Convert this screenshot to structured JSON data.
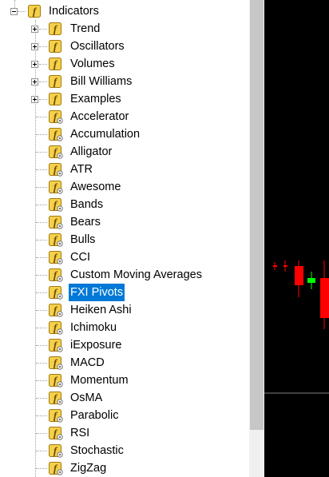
{
  "tree": {
    "root": {
      "label": "Indicators",
      "icon": "indicator-folder-icon",
      "expanded": true
    },
    "folders": [
      {
        "label": "Trend"
      },
      {
        "label": "Oscillators"
      },
      {
        "label": "Volumes"
      },
      {
        "label": "Bill Williams"
      },
      {
        "label": "Examples"
      }
    ],
    "items": [
      {
        "label": "Accelerator"
      },
      {
        "label": "Accumulation"
      },
      {
        "label": "Alligator"
      },
      {
        "label": "ATR"
      },
      {
        "label": "Awesome"
      },
      {
        "label": "Bands"
      },
      {
        "label": "Bears"
      },
      {
        "label": "Bulls"
      },
      {
        "label": "CCI"
      },
      {
        "label": "Custom Moving Averages"
      },
      {
        "label": "FXI Pivots",
        "selected": true
      },
      {
        "label": "Heiken Ashi"
      },
      {
        "label": "Ichimoku"
      },
      {
        "label": "iExposure"
      },
      {
        "label": "MACD"
      },
      {
        "label": "Momentum"
      },
      {
        "label": "OsMA"
      },
      {
        "label": "Parabolic"
      },
      {
        "label": "RSI"
      },
      {
        "label": "Stochastic"
      },
      {
        "label": "ZigZag"
      }
    ]
  },
  "colors": {
    "selection": "#0078d7",
    "icon_fill": "#f5d04a",
    "chart_background": "#000000",
    "bear_candle": "#ff0000",
    "bull_candle": "#00ff00",
    "chart_border": "#808080"
  }
}
